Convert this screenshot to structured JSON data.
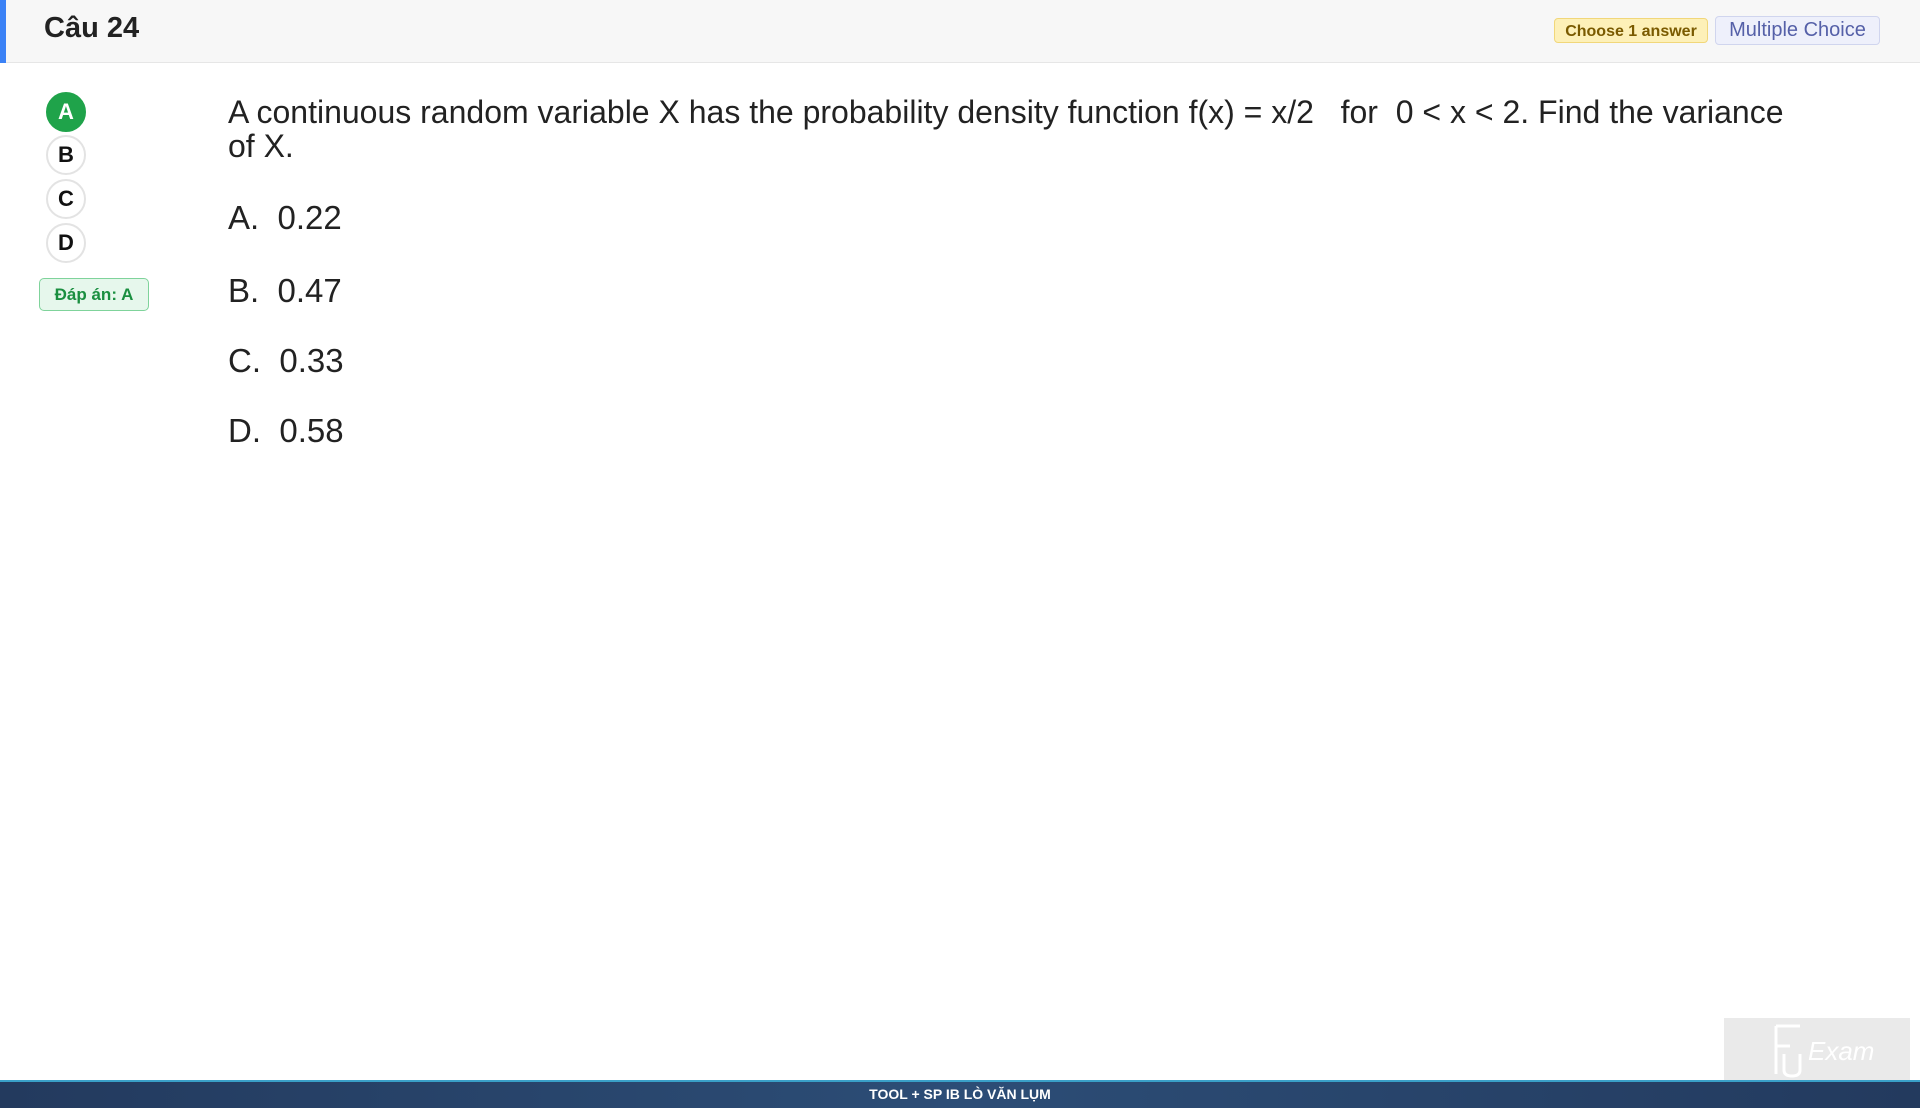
{
  "header": {
    "title": "Câu 24",
    "choose_badge": "Choose 1 answer",
    "type_badge": "Multiple Choice",
    "accent_color": "#3b82f6"
  },
  "options_panel": {
    "items": [
      {
        "label": "A",
        "selected": true
      },
      {
        "label": "B",
        "selected": false
      },
      {
        "label": "C",
        "selected": false
      },
      {
        "label": "D",
        "selected": false
      }
    ],
    "selected_color": "#1fa34a",
    "answer_badge": "Đáp án: A"
  },
  "question": {
    "text": "A continuous random variable X has the probability density function f(x) = x/2   for  0 < x < 2. Find the variance of X.",
    "choices": [
      {
        "letter": "A.",
        "value": "0.22"
      },
      {
        "letter": "B.",
        "value": "0.47"
      },
      {
        "letter": "C.",
        "value": "0.33"
      },
      {
        "letter": "D.",
        "value": "0.58"
      }
    ]
  },
  "watermark": {
    "text": "Exam",
    "icon": "fu-exam-logo"
  },
  "footer": {
    "text": "TOOL + SP IB LÒ VĂN LỤM"
  }
}
